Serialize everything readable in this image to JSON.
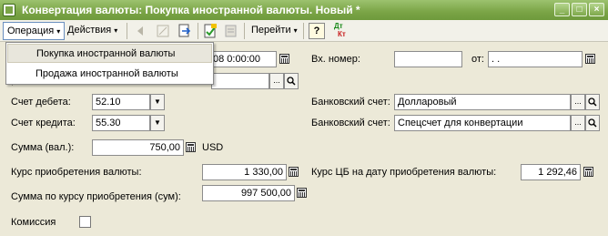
{
  "window": {
    "title": "Конвертация валюты: Покупка иностранной валюты. Новый *",
    "minimize_glyph": "_",
    "maximize_glyph": "□",
    "close_glyph": "×"
  },
  "toolbar": {
    "operation_label": "Операция",
    "actions_label": "Действия",
    "goto_label": "Перейти",
    "help_label": "?",
    "dtkt_top": "Дт",
    "dtkt_bottom": "Кт",
    "dropdown_arrow": "▾"
  },
  "operation_menu": {
    "items": [
      "Покупка иностранной валюты",
      "Продажа иностранной валюты"
    ]
  },
  "form": {
    "date_partial": "08  0:00:00",
    "incoming_number_label": "Вх. номер:",
    "incoming_number_value": "",
    "from_label": "от:",
    "from_value": " .  .",
    "debit_account_label": "Счет дебета:",
    "debit_account_value": "52.10",
    "credit_account_label": "Счет кредита:",
    "credit_account_value": "55.30",
    "bank_account_label_1": "Банковский счет:",
    "bank_account_value_1": "Долларовый",
    "bank_account_label_2": "Банковский счет:",
    "bank_account_value_2": "Спецсчет для конвертации",
    "amount_label": "Сумма (вал.):",
    "amount_value": "750,00",
    "currency": "USD",
    "purchase_rate_label": "Курс приобретения валюты:",
    "purchase_rate_value": "1 330,00",
    "cb_rate_label": "Курс ЦБ на дату приобретения валюты:",
    "cb_rate_value": "1 292,46",
    "amount_purchase_label": "Сумма по курсу приобретения (сум):",
    "amount_purchase_value": "997 500,00",
    "commission_label": "Комиссия",
    "commission_checked": false,
    "ellipsis": "...",
    "search_glyph": "🔍",
    "dropdown_glyph": "▼"
  }
}
